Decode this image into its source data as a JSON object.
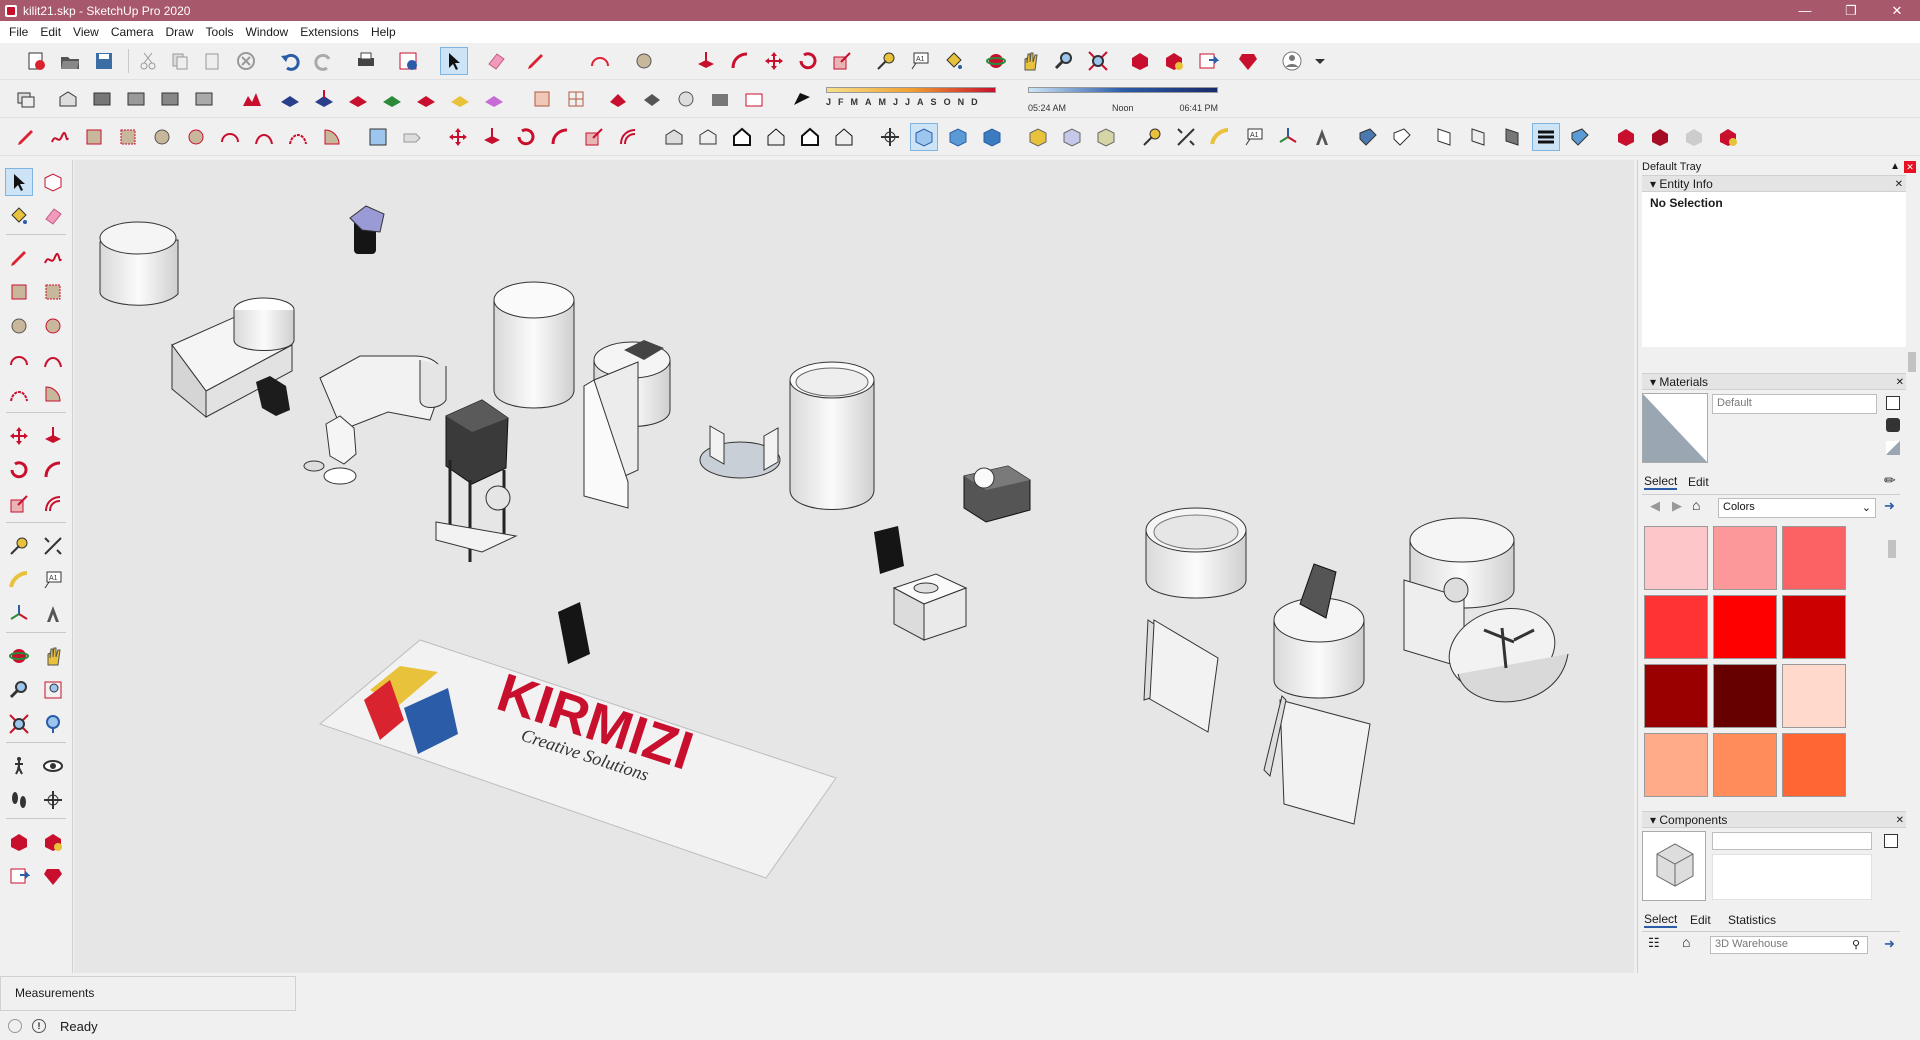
{
  "window": {
    "title": "kilit21.skp - SketchUp Pro 2020",
    "minimize": "—",
    "restore": "❐",
    "close": "✕"
  },
  "menu": [
    "File",
    "Edit",
    "View",
    "Camera",
    "Draw",
    "Tools",
    "Window",
    "Extensions",
    "Help"
  ],
  "shadow_panel": {
    "months": [
      "J",
      "F",
      "M",
      "A",
      "M",
      "J",
      "J",
      "A",
      "S",
      "O",
      "N",
      "D"
    ],
    "time_start": "05:24 AM",
    "time_noon": "Noon",
    "time_end": "06:41 PM"
  },
  "tray": {
    "title": "Default Tray",
    "entity_info": {
      "header": "Entity Info",
      "selection": "No Selection"
    },
    "materials": {
      "header": "Materials",
      "name_value": "Default",
      "tab_select": "Select",
      "tab_edit": "Edit",
      "library": "Colors",
      "swatch_colors": [
        "#fdc7c9",
        "#fc979a",
        "#fb6264",
        "#ff3333",
        "#ff0000",
        "#cc0000",
        "#990000",
        "#660000",
        "#ffd9cc",
        "#ffab8a",
        "#ff8c5a",
        "#ff6633",
        "#ff5500",
        "#e64d00",
        "#b33c00"
      ]
    },
    "components": {
      "header": "Components",
      "tab_select": "Select",
      "tab_edit": "Edit",
      "tab_statistics": "Statistics",
      "search_placeholder": "3D Warehouse"
    }
  },
  "measurements": {
    "label": "Measurements"
  },
  "status": {
    "text": "Ready"
  },
  "scene_logo": {
    "brand": "KIRMIZI",
    "tagline": "Creative Solutions"
  }
}
